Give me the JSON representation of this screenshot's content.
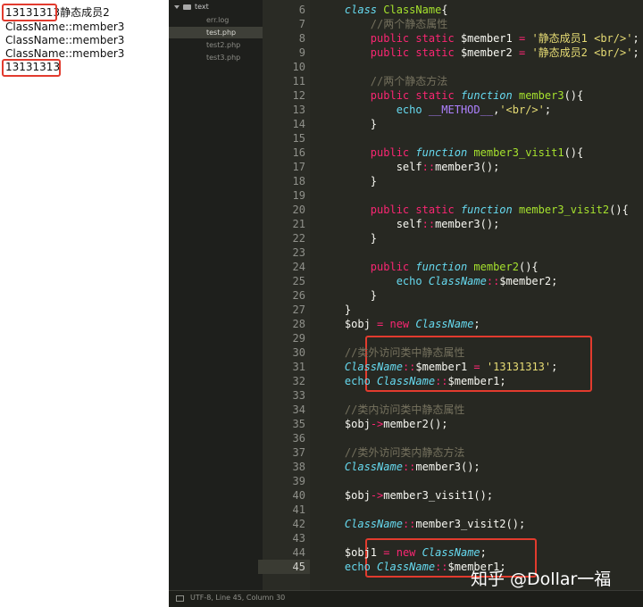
{
  "output": {
    "lines": [
      "13131313静态成员2",
      "ClassName::member3",
      "ClassName::member3",
      "ClassName::member3",
      "13131313"
    ]
  },
  "sidebar": {
    "folder": "text",
    "files": [
      "err.log",
      "test.php",
      "test2.php",
      "test3.php"
    ],
    "active": "test.php"
  },
  "gutter": [
    "6",
    "7",
    "8",
    "9",
    "10",
    "11",
    "12",
    "13",
    "14",
    "15",
    "16",
    "17",
    "18",
    "19",
    "20",
    "21",
    "22",
    "23",
    "24",
    "25",
    "26",
    "27",
    "28",
    "29",
    "30",
    "31",
    "32",
    "33",
    "34",
    "35",
    "36",
    "37",
    "38",
    "39",
    "40",
    "41",
    "42",
    "43",
    "44",
    "45"
  ],
  "code": [
    [
      [
        "    ",
        "pl"
      ],
      [
        "class ",
        "st"
      ],
      [
        "ClassName",
        "cn"
      ],
      [
        "{",
        "pl"
      ]
    ],
    [
      [
        "        ",
        "pl"
      ],
      [
        "//两个静态属性",
        "cm"
      ]
    ],
    [
      [
        "        ",
        "pl"
      ],
      [
        "public ",
        "kw"
      ],
      [
        "static ",
        "kw"
      ],
      [
        "$member1 ",
        "pl"
      ],
      [
        "= ",
        "kw"
      ],
      [
        "'静态成员1 <br/>'",
        "sr"
      ],
      [
        ";",
        "pl"
      ]
    ],
    [
      [
        "        ",
        "pl"
      ],
      [
        "public ",
        "kw"
      ],
      [
        "static ",
        "kw"
      ],
      [
        "$member2 ",
        "pl"
      ],
      [
        "= ",
        "kw"
      ],
      [
        "'静态成员2 <br/>'",
        "sr"
      ],
      [
        ";",
        "pl"
      ]
    ],
    [
      [
        "",
        "pl"
      ]
    ],
    [
      [
        "        ",
        "pl"
      ],
      [
        "//两个静态方法",
        "cm"
      ]
    ],
    [
      [
        "        ",
        "pl"
      ],
      [
        "public ",
        "kw"
      ],
      [
        "static ",
        "kw"
      ],
      [
        "function ",
        "st"
      ],
      [
        "member3",
        "cn"
      ],
      [
        "(){",
        "pl"
      ]
    ],
    [
      [
        "            ",
        "pl"
      ],
      [
        "echo ",
        "bl"
      ],
      [
        "__METHOD__",
        "mg"
      ],
      [
        ",",
        "pl"
      ],
      [
        "'<br/>'",
        "sr"
      ],
      [
        ";",
        "pl"
      ]
    ],
    [
      [
        "        ",
        "pl"
      ],
      [
        "}",
        "pl"
      ]
    ],
    [
      [
        "",
        "pl"
      ]
    ],
    [
      [
        "        ",
        "pl"
      ],
      [
        "public ",
        "kw"
      ],
      [
        "function ",
        "st"
      ],
      [
        "member3_visit1",
        "cn"
      ],
      [
        "(){",
        "pl"
      ]
    ],
    [
      [
        "            ",
        "pl"
      ],
      [
        "self",
        "pl"
      ],
      [
        "::",
        "kw"
      ],
      [
        "member3",
        "pl"
      ],
      [
        "();",
        "pl"
      ]
    ],
    [
      [
        "        ",
        "pl"
      ],
      [
        "}",
        "pl"
      ]
    ],
    [
      [
        "",
        "pl"
      ]
    ],
    [
      [
        "        ",
        "pl"
      ],
      [
        "public ",
        "kw"
      ],
      [
        "static ",
        "kw"
      ],
      [
        "function ",
        "st"
      ],
      [
        "member3_visit2",
        "cn"
      ],
      [
        "(){",
        "pl"
      ]
    ],
    [
      [
        "            ",
        "pl"
      ],
      [
        "self",
        "pl"
      ],
      [
        "::",
        "kw"
      ],
      [
        "member3",
        "pl"
      ],
      [
        "();",
        "pl"
      ]
    ],
    [
      [
        "        ",
        "pl"
      ],
      [
        "}",
        "pl"
      ]
    ],
    [
      [
        "",
        "pl"
      ]
    ],
    [
      [
        "        ",
        "pl"
      ],
      [
        "public ",
        "kw"
      ],
      [
        "function ",
        "st"
      ],
      [
        "member2",
        "cn"
      ],
      [
        "(){",
        "pl"
      ]
    ],
    [
      [
        "            ",
        "pl"
      ],
      [
        "echo ",
        "bl"
      ],
      [
        "ClassName",
        "st"
      ],
      [
        "::",
        "kw"
      ],
      [
        "$member2",
        "pl"
      ],
      [
        ";",
        "pl"
      ]
    ],
    [
      [
        "        ",
        "pl"
      ],
      [
        "}",
        "pl"
      ]
    ],
    [
      [
        "    ",
        "pl"
      ],
      [
        "}",
        "pl"
      ]
    ],
    [
      [
        "    ",
        "pl"
      ],
      [
        "$obj ",
        "pl"
      ],
      [
        "= ",
        "kw"
      ],
      [
        "new ",
        "kw"
      ],
      [
        "ClassName",
        "st"
      ],
      [
        ";",
        "pl"
      ]
    ],
    [
      [
        "",
        "pl"
      ]
    ],
    [
      [
        "    ",
        "pl"
      ],
      [
        "//类外访问类中静态属性",
        "cm"
      ]
    ],
    [
      [
        "    ",
        "pl"
      ],
      [
        "ClassName",
        "st"
      ],
      [
        "::",
        "kw"
      ],
      [
        "$member1 ",
        "pl"
      ],
      [
        "= ",
        "kw"
      ],
      [
        "'13131313'",
        "sr"
      ],
      [
        ";",
        "pl"
      ]
    ],
    [
      [
        "    ",
        "pl"
      ],
      [
        "echo ",
        "bl"
      ],
      [
        "ClassName",
        "st"
      ],
      [
        "::",
        "kw"
      ],
      [
        "$member1",
        "pl"
      ],
      [
        ";",
        "pl"
      ]
    ],
    [
      [
        "",
        "pl"
      ]
    ],
    [
      [
        "    ",
        "pl"
      ],
      [
        "//类内访问类中静态属性",
        "cm"
      ]
    ],
    [
      [
        "    ",
        "pl"
      ],
      [
        "$obj",
        "pl"
      ],
      [
        "->",
        "kw"
      ],
      [
        "member2",
        "pl"
      ],
      [
        "();",
        "pl"
      ]
    ],
    [
      [
        "",
        "pl"
      ]
    ],
    [
      [
        "    ",
        "pl"
      ],
      [
        "//类外访问类内静态方法",
        "cm"
      ]
    ],
    [
      [
        "    ",
        "pl"
      ],
      [
        "ClassName",
        "st"
      ],
      [
        "::",
        "kw"
      ],
      [
        "member3",
        "pl"
      ],
      [
        "();",
        "pl"
      ]
    ],
    [
      [
        "",
        "pl"
      ]
    ],
    [
      [
        "    ",
        "pl"
      ],
      [
        "$obj",
        "pl"
      ],
      [
        "->",
        "kw"
      ],
      [
        "member3_visit1",
        "pl"
      ],
      [
        "();",
        "pl"
      ]
    ],
    [
      [
        "",
        "pl"
      ]
    ],
    [
      [
        "    ",
        "pl"
      ],
      [
        "ClassName",
        "st"
      ],
      [
        "::",
        "kw"
      ],
      [
        "member3_visit2",
        "pl"
      ],
      [
        "();",
        "pl"
      ]
    ],
    [
      [
        "",
        "pl"
      ]
    ],
    [
      [
        "    ",
        "pl"
      ],
      [
        "$obj1 ",
        "pl"
      ],
      [
        "= ",
        "kw"
      ],
      [
        "new ",
        "kw"
      ],
      [
        "ClassName",
        "st"
      ],
      [
        ";",
        "pl"
      ]
    ],
    [
      [
        "    ",
        "pl"
      ],
      [
        "echo ",
        "bl"
      ],
      [
        "ClassName",
        "st"
      ],
      [
        "::",
        "kw"
      ],
      [
        "$member1",
        "pl"
      ],
      [
        ";",
        "pl"
      ]
    ]
  ],
  "status": "UTF-8, Line 45, Column 30",
  "watermark": "知乎 @Dollar一福",
  "colors": {
    "highlight_box": "#e23b2e",
    "editor_bg": "#272822"
  }
}
